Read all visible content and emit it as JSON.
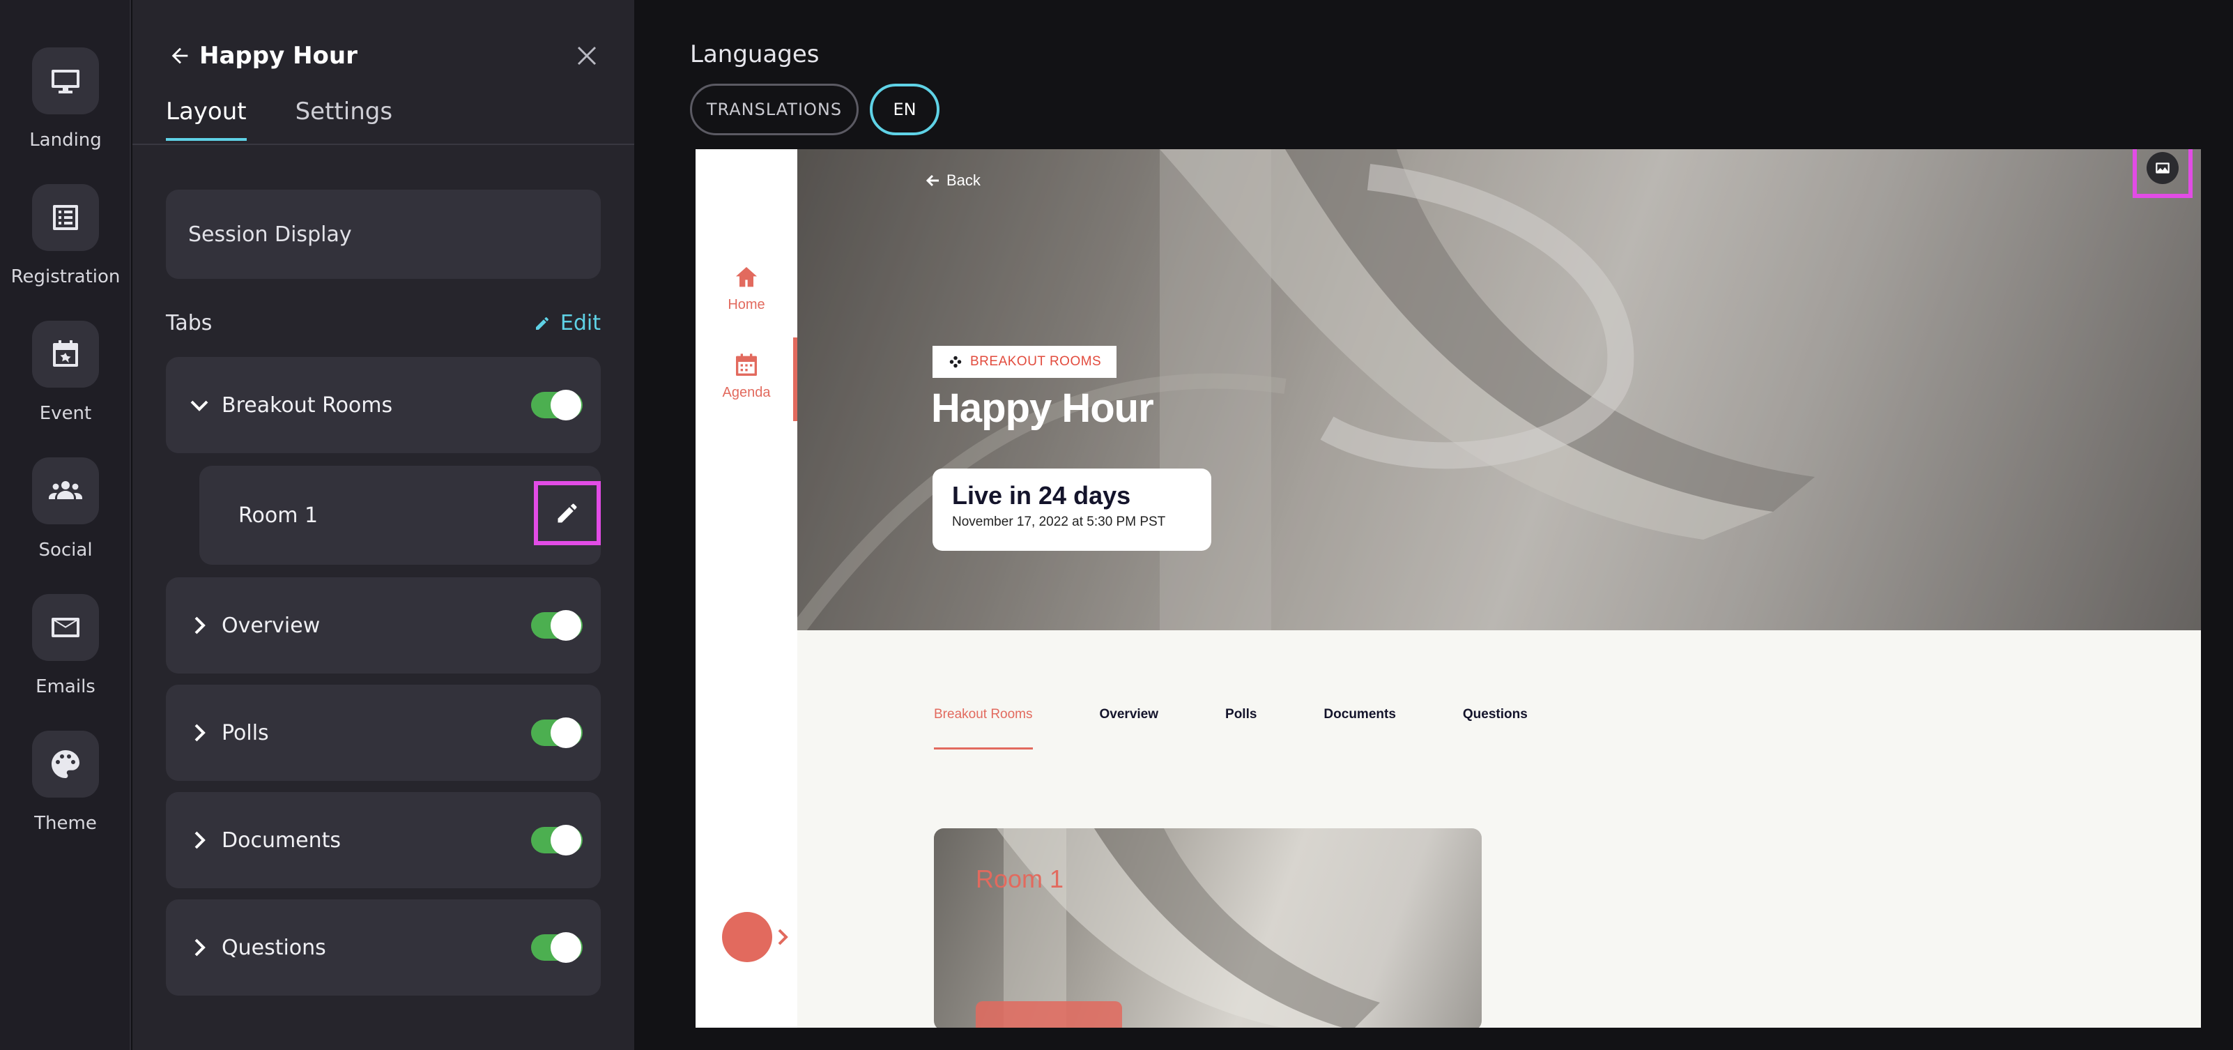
{
  "rail": {
    "items": [
      {
        "label": "Landing",
        "icon": "monitor-icon"
      },
      {
        "label": "Registration",
        "icon": "list-icon"
      },
      {
        "label": "Event",
        "icon": "calendar-icon"
      },
      {
        "label": "Social",
        "icon": "people-icon"
      },
      {
        "label": "Emails",
        "icon": "mail-icon"
      },
      {
        "label": "Theme",
        "icon": "palette-icon"
      }
    ]
  },
  "panel": {
    "title": "Happy Hour",
    "tabs": [
      {
        "label": "Layout",
        "active": true
      },
      {
        "label": "Settings",
        "active": false
      }
    ],
    "session_display": "Session Display",
    "tabs_section_label": "Tabs",
    "edit_label": "Edit",
    "tab_items": [
      {
        "label": "Breakout Rooms",
        "expanded": true,
        "enabled": true
      },
      {
        "label": "Overview",
        "expanded": false,
        "enabled": true
      },
      {
        "label": "Polls",
        "expanded": false,
        "enabled": true
      },
      {
        "label": "Documents",
        "expanded": false,
        "enabled": true
      },
      {
        "label": "Questions",
        "expanded": false,
        "enabled": true
      }
    ],
    "room_item": "Room 1"
  },
  "languages": {
    "title": "Languages",
    "translations_label": "TRANSLATIONS",
    "current_language": "EN"
  },
  "preview": {
    "nav": [
      {
        "label": "Home",
        "icon": "home-icon"
      },
      {
        "label": "Agenda",
        "icon": "calendar-icon"
      }
    ],
    "back_label": "Back",
    "badge_label": "BREAKOUT ROOMS",
    "session_title": "Happy Hour",
    "live_main": "Live in 24 days",
    "live_sub": "November 17, 2022 at 5:30 PM PST",
    "content_tabs": [
      "Breakout Rooms",
      "Overview",
      "Polls",
      "Documents",
      "Questions"
    ],
    "room_tile_label": "Room 1"
  },
  "colors": {
    "accent": "#5fd2e6",
    "toggle_on": "#4caf50",
    "brand": "#e26a5e",
    "highlight": "#e24ce6"
  }
}
